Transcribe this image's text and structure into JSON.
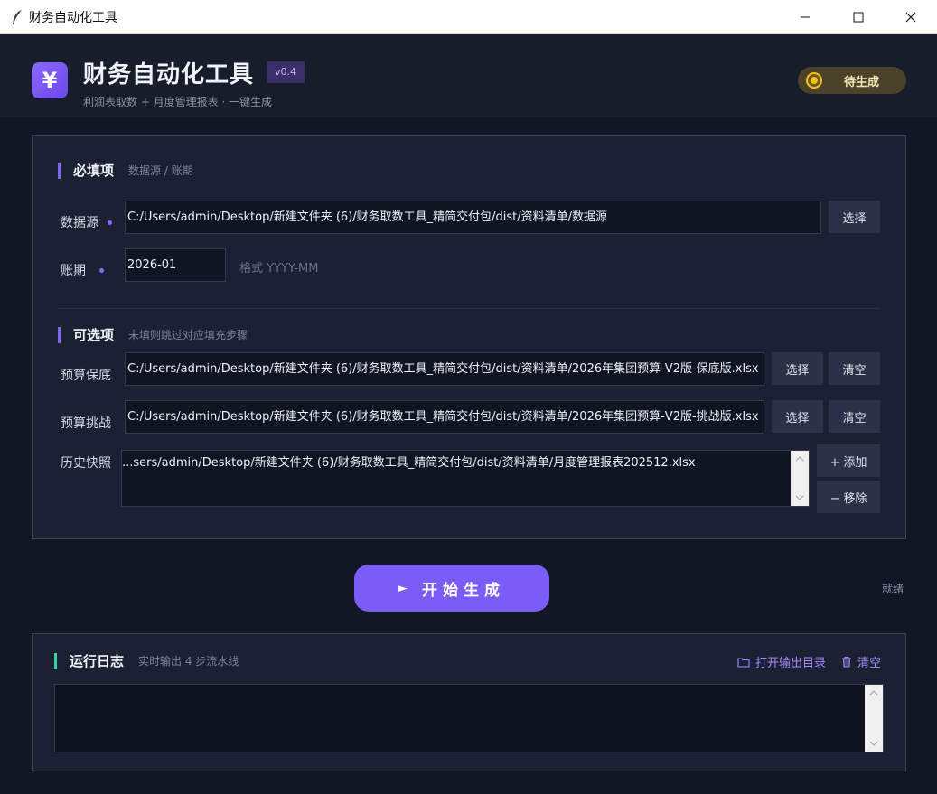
{
  "window": {
    "title": "财务自动化工具",
    "icon": "feather-icon"
  },
  "header": {
    "logo_symbol": "¥",
    "title": "财务自动化工具",
    "version": "v0.4",
    "subtitle": "利润表取数 + 月度管理报表 · 一键生成",
    "status": "待生成",
    "status_color": "#f5c020"
  },
  "required": {
    "title": "必填项",
    "subtitle": "数据源 / 账期",
    "datasource": {
      "label": "数据源",
      "value": "C:/Users/admin/Desktop/新建文件夹 (6)/财务取数工具_精简交付包/dist/资料清单/数据源",
      "choose": "选择"
    },
    "period": {
      "label": "账期",
      "value": "2026-01",
      "hint": "格式 YYYY-MM"
    }
  },
  "optional": {
    "title": "可选项",
    "subtitle": "未填则跳过对应填充步骤",
    "budget_base": {
      "label": "预算保底",
      "value": "C:/Users/admin/Desktop/新建文件夹 (6)/财务取数工具_精简交付包/dist/资料清单/2026年集团预算-V2版-保底版.xlsx",
      "choose": "选择",
      "clear": "清空"
    },
    "budget_challenge": {
      "label": "预算挑战",
      "value": "C:/Users/admin/Desktop/新建文件夹 (6)/财务取数工具_精简交付包/dist/资料清单/2026年集团预算-V2版-挑战版.xlsx",
      "choose": "选择",
      "clear": "清空"
    },
    "history": {
      "label": "历史快照",
      "items": [
        "...sers/admin/Desktop/新建文件夹 (6)/财务取数工具_精简交付包/dist/资料清单/月度管理报表202512.xlsx"
      ],
      "add": "+ 添加",
      "remove": "− 移除"
    }
  },
  "generate": {
    "label": "开始生成",
    "play": "►",
    "state": "就绪"
  },
  "log": {
    "title": "运行日志",
    "subtitle": "实时输出 4 步流水线",
    "open_output": "打开输出目录",
    "clear": "清空",
    "content": ""
  },
  "colors": {
    "accent": "#7c5cf6",
    "log_bar": "#35d39a",
    "background": "#121725"
  }
}
